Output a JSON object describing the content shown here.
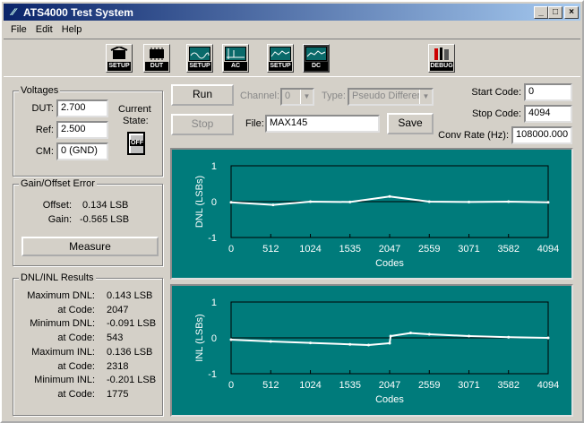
{
  "window": {
    "title": "ATS4000 Test System",
    "logo": "ats-logo-icon",
    "controls": [
      "_",
      "□",
      "×"
    ]
  },
  "menu": [
    "File",
    "Edit",
    "Help"
  ],
  "toolbar": [
    {
      "icon": "setup-chip-icon",
      "label": "SETUP"
    },
    {
      "icon": "dut-chip-icon",
      "label": "DUT"
    },
    {
      "icon": "ac-setup-icon",
      "label": "SETUP"
    },
    {
      "icon": "ac-chart-icon",
      "label": "AC"
    },
    {
      "icon": "dc-setup-icon",
      "label": "SETUP"
    },
    {
      "icon": "dc-chart-icon",
      "label": "DC"
    },
    {
      "icon": "debug-tools-icon",
      "label": "DEBUG"
    }
  ],
  "voltages": {
    "title": "Voltages",
    "dut_label": "DUT:",
    "dut": "2.700",
    "ref_label": "Ref:",
    "ref": "2.500",
    "cm_label": "CM:",
    "cm": "0 (GND)",
    "state_label": "Current",
    "state_label2": "State:",
    "switch": "OFF"
  },
  "gain": {
    "title": "Gain/Offset Error",
    "offset_label": "Offset:",
    "offset": "0.134 LSB",
    "gain_label": "Gain:",
    "gain": "-0.565 LSB",
    "measure": "Measure"
  },
  "results": {
    "title": "DNL/INL Results",
    "rows": [
      {
        "label": "Maximum DNL:",
        "value": "0.143 LSB"
      },
      {
        "label": "at Code:",
        "value": "2047"
      },
      {
        "label": "Minimum DNL:",
        "value": "-0.091 LSB"
      },
      {
        "label": "at Code:",
        "value": "543"
      },
      {
        "label": "Maximum INL:",
        "value": "0.136 LSB"
      },
      {
        "label": "at Code:",
        "value": "2318"
      },
      {
        "label": "Minimum INL:",
        "value": "-0.201 LSB"
      },
      {
        "label": "at Code:",
        "value": "1775"
      }
    ]
  },
  "controls": {
    "run": "Run",
    "stop": "Stop",
    "channel_label": "Channel:",
    "channel": "0",
    "type_label": "Type:",
    "type": "Pseudo Differer",
    "file_label": "File:",
    "file": "MAX145",
    "save": "Save",
    "start_label": "Start Code:",
    "start": "0",
    "stop_label": "Stop Code:",
    "stop_code": "4094",
    "rate_label": "Conv Rate (Hz):",
    "rate": "108000.000"
  },
  "colors": {
    "plot_bg": "#007b7b",
    "trace": "#ffffff"
  },
  "chart_data": [
    {
      "type": "line",
      "ylabel": "DNL (LSBs)",
      "xlabel": "Codes",
      "xticks": [
        "0",
        "512",
        "1024",
        "1535",
        "2047",
        "2559",
        "3071",
        "3582",
        "4094"
      ],
      "yticks": [
        "1",
        "0",
        "-1"
      ],
      "ylim": [
        -1,
        1
      ],
      "xlim": [
        0,
        4094
      ],
      "series": [
        {
          "values_summary": "noise around 0",
          "points": [
            [
              0,
              -0.02
            ],
            [
              543,
              -0.091
            ],
            [
              1024,
              0.0
            ],
            [
              1535,
              -0.01
            ],
            [
              2047,
              0.143
            ],
            [
              2559,
              0.0
            ],
            [
              3071,
              -0.01
            ],
            [
              3582,
              0.0
            ],
            [
              4094,
              -0.02
            ]
          ]
        }
      ]
    },
    {
      "type": "line",
      "ylabel": "INL (LSBs)",
      "xlabel": "Codes",
      "xticks": [
        "0",
        "512",
        "1024",
        "1535",
        "2047",
        "2559",
        "3071",
        "3582",
        "4094"
      ],
      "yticks": [
        "1",
        "0",
        "-1"
      ],
      "ylim": [
        -1,
        1
      ],
      "xlim": [
        0,
        4094
      ],
      "series": [
        {
          "points": [
            [
              0,
              -0.05
            ],
            [
              512,
              -0.1
            ],
            [
              1024,
              -0.14
            ],
            [
              1535,
              -0.18
            ],
            [
              1775,
              -0.201
            ],
            [
              2047,
              -0.15
            ],
            [
              2060,
              0.05
            ],
            [
              2318,
              0.136
            ],
            [
              2559,
              0.1
            ],
            [
              3071,
              0.05
            ],
            [
              3582,
              0.02
            ],
            [
              4094,
              0.0
            ]
          ]
        }
      ]
    }
  ]
}
